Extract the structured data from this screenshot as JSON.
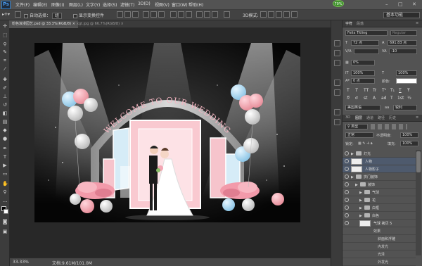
{
  "menubar": {
    "items": [
      "文件(F)",
      "编辑(E)",
      "图像(I)",
      "图层(L)",
      "文字(Y)",
      "选择(S)",
      "滤镜(T)",
      "3D(D)",
      "视图(V)",
      "窗口(W)",
      "帮助(H)"
    ],
    "badge": "70%"
  },
  "options": {
    "auto_select": "自动选择：",
    "auto_select_target": "组",
    "show_transform": "显示变换控件",
    "workspace": "基本功能"
  },
  "tabs": [
    {
      "label": "粉色浪漫园艺.psd @ 33.3%(RGB/8) ×"
    },
    {
      "label": "xgt.jpg @ 66.7%(RGB/8) ×"
    }
  ],
  "status": {
    "zoom": "33.33%",
    "doc": "文档:9.61M/101.0M"
  },
  "artwork": {
    "arch_text": "WELCOME TO OUR WEDDING"
  },
  "char_panel": {
    "tabs": [
      "字符",
      "段落"
    ],
    "font_family": "Felix Titling",
    "font_style": "Regular",
    "size": "72 点",
    "leading": "691.83 点",
    "tracking_a": "",
    "tracking_b": "-10",
    "baseline": "0%",
    "scale_v": "100%",
    "scale_h": "100%",
    "shift": "0 点",
    "color_label": "颜色:",
    "format_buttons": [
      "T",
      "T",
      "TT",
      "Tr",
      "T¹",
      "T₁",
      "T",
      "Ŧ"
    ],
    "ot_buttons": [
      "fi",
      "ơ",
      "st",
      "A",
      "ad",
      "T",
      "1st",
      "½"
    ],
    "language": "美国英语",
    "aa_label": "aa",
    "aa_value": "锐利"
  },
  "layers_panel": {
    "tabs": [
      "3D",
      "图层",
      "通道",
      "路径",
      "历史"
    ],
    "filter_label": "类型",
    "blend_mode": "正常",
    "opacity_label": "不透明度:",
    "opacity": "100%",
    "lock_label": "锁定:",
    "fill_label": "填充:",
    "fill": "100%",
    "layers": [
      {
        "name": "灯光",
        "kind": "group",
        "indent": 0,
        "selected": false
      },
      {
        "name": "人物",
        "kind": "layer",
        "indent": 0,
        "selected": true
      },
      {
        "name": "人物影子",
        "kind": "layer",
        "indent": 0,
        "selected": true
      },
      {
        "name": "拱门装饰",
        "kind": "group",
        "indent": 0,
        "selected": false
      },
      {
        "name": "装饰",
        "kind": "group",
        "indent": 1,
        "selected": false
      },
      {
        "name": "气球",
        "kind": "group",
        "indent": 2,
        "selected": false
      },
      {
        "name": "花",
        "kind": "group",
        "indent": 2,
        "selected": false
      },
      {
        "name": "白框",
        "kind": "group",
        "indent": 2,
        "selected": false
      },
      {
        "name": "白色",
        "kind": "group",
        "indent": 2,
        "selected": false
      },
      {
        "name": "气球 拷贝 5",
        "kind": "layer",
        "indent": 2,
        "selected": false
      },
      {
        "name": "效果",
        "kind": "fx",
        "indent": 3,
        "selected": false
      },
      {
        "name": "斜面和浮雕",
        "kind": "fx",
        "indent": 4,
        "selected": false
      },
      {
        "name": "内发光",
        "kind": "fx",
        "indent": 4,
        "selected": false
      },
      {
        "name": "光泽",
        "kind": "fx",
        "indent": 4,
        "selected": false
      },
      {
        "name": "外发光",
        "kind": "fx",
        "indent": 4,
        "selected": false
      }
    ]
  }
}
